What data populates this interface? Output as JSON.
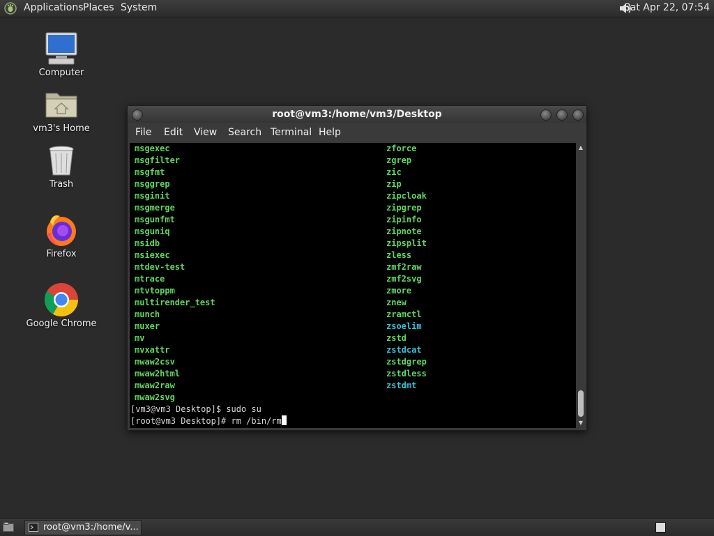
{
  "top_panel": {
    "menus": [
      "Applications",
      "Places",
      "System"
    ],
    "clock": "Sat Apr 22, 07:54",
    "icons": [
      "foot-menu-icon",
      "volume-icon"
    ]
  },
  "desktop": {
    "icons": [
      {
        "label": "Computer",
        "icon": "computer-icon"
      },
      {
        "label": "vm3's Home",
        "icon": "home-folder-icon"
      },
      {
        "label": "Trash",
        "icon": "trash-icon"
      },
      {
        "label": "Firefox",
        "icon": "firefox-icon"
      },
      {
        "label": "Google Chrome",
        "icon": "chrome-icon"
      }
    ]
  },
  "terminal": {
    "title": "root@vm3:/home/vm3/Desktop",
    "menu": [
      "File",
      "Edit",
      "View",
      "Search",
      "Terminal",
      "Help"
    ],
    "left_column": [
      "msgexec",
      "msgfilter",
      "msgfmt",
      "msggrep",
      "msginit",
      "msgmerge",
      "msgunfmt",
      "msguniq",
      "msidb",
      "msiexec",
      "mtdev-test",
      "mtrace",
      "mtvtoppm",
      "multirender_test",
      "munch",
      "muxer",
      "mv",
      "mvxattr",
      "mwaw2csv",
      "mwaw2html",
      "mwaw2raw",
      "mwaw2svg"
    ],
    "right_column": [
      {
        "text": "zforce",
        "color": "green"
      },
      {
        "text": "zgrep",
        "color": "green"
      },
      {
        "text": "zic",
        "color": "green"
      },
      {
        "text": "zip",
        "color": "green"
      },
      {
        "text": "zipcloak",
        "color": "green"
      },
      {
        "text": "zipgrep",
        "color": "green"
      },
      {
        "text": "zipinfo",
        "color": "green"
      },
      {
        "text": "zipnote",
        "color": "green"
      },
      {
        "text": "zipsplit",
        "color": "green"
      },
      {
        "text": "zless",
        "color": "green"
      },
      {
        "text": "zmf2raw",
        "color": "green"
      },
      {
        "text": "zmf2svg",
        "color": "green"
      },
      {
        "text": "zmore",
        "color": "green"
      },
      {
        "text": "znew",
        "color": "green"
      },
      {
        "text": "zramctl",
        "color": "green"
      },
      {
        "text": "zsoelim",
        "color": "cyan"
      },
      {
        "text": "zstd",
        "color": "green"
      },
      {
        "text": "zstdcat",
        "color": "cyan"
      },
      {
        "text": "zstdgrep",
        "color": "green"
      },
      {
        "text": "zstdless",
        "color": "green"
      },
      {
        "text": "zstdmt",
        "color": "cyan"
      }
    ],
    "prompt_lines": [
      "[vm3@vm3 Desktop]$ sudo su",
      "[root@vm3 Desktop]# rm /bin/rm"
    ],
    "colors": {
      "green": "#5fd75f",
      "cyan": "#36c0d2",
      "background": "#000000"
    }
  },
  "taskbar": {
    "task_label": "root@vm3:/home/v...",
    "icons": [
      "show-desktop-icon",
      "terminal-icon",
      "workspace-switcher"
    ]
  }
}
